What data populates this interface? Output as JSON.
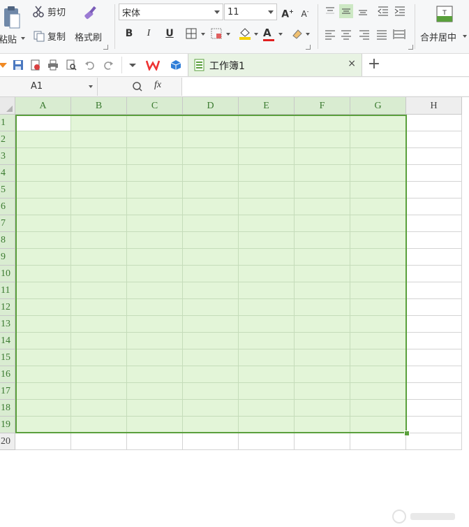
{
  "ribbon": {
    "paste_label": "粘贴",
    "cut_label": "剪切",
    "copy_label": "复制",
    "format_painter_label": "格式刷",
    "font_name": "宋体",
    "font_size": "11",
    "bold_label": "B",
    "italic_label": "I",
    "underline_label": "U",
    "merge_center_label": "合并居中"
  },
  "tabbar": {
    "document_tab_label": "工作簿1",
    "close_glyph": "×",
    "new_tab_glyph": "+"
  },
  "formula_bar": {
    "name_box_value": "A1",
    "fx_label": "fx",
    "formula_value": ""
  },
  "sheet": {
    "columns": [
      "A",
      "B",
      "C",
      "D",
      "E",
      "F",
      "G",
      "H"
    ],
    "selected_columns": [
      "A",
      "B",
      "C",
      "D",
      "E",
      "F",
      "G"
    ],
    "rows": [
      "1",
      "2",
      "3",
      "4",
      "5",
      "6",
      "7",
      "8",
      "9",
      "10",
      "11",
      "12",
      "13",
      "14",
      "15",
      "16",
      "17",
      "18",
      "19",
      "20"
    ],
    "selected_rows_last": "19",
    "selection_range": "A1:G19",
    "active_cell": "A1"
  },
  "colors": {
    "selection_fill": "#e3f5d8",
    "selection_border": "#5aa03c",
    "header_selected_text": "#3a7a2f",
    "font_color_bar": "#e02020",
    "fill_color_bar": "#f5d000"
  }
}
